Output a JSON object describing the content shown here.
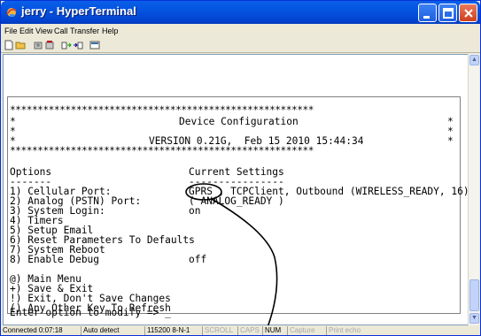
{
  "window": {
    "title": "jerry - HyperTerminal"
  },
  "menu": [
    "File",
    "Edit",
    "View",
    "Call",
    "Transfer",
    "Help"
  ],
  "toolbar": {
    "icons": [
      "new-icon",
      "open-icon",
      "phone-icon",
      "disconnect-icon",
      "send-icon",
      "receive-icon",
      "properties-icon"
    ]
  },
  "terminal": {
    "star_line": "*******************************************************",
    "header_title": "Device Configuration",
    "header_version": "VERSION 0.21G,  Feb 15 2010 15:44:34",
    "col_options": "Options",
    "col_options_rule": "-------",
    "col_settings": "Current Settings",
    "col_settings_rule": "----------------",
    "options": [
      {
        "label": "1) Cellular Port:",
        "value": "GPRS , TCPClient, Outbound (WIRELESS_READY, 16)"
      },
      {
        "label": "2) Analog (PSTN) Port:",
        "value": "( ANALOG_READY )"
      },
      {
        "label": "3) System Login:",
        "value": "on"
      },
      {
        "label": "4) Timers",
        "value": ""
      },
      {
        "label": "5) Setup Email",
        "value": ""
      },
      {
        "label": "6) Reset Parameters To Defaults",
        "value": ""
      },
      {
        "label": "7) System Reboot",
        "value": ""
      },
      {
        "label": "8) Enable Debug",
        "value": "off"
      }
    ],
    "commands": [
      "@) Main Menu",
      "+) Save & Exit",
      "!) Exit, Don't Save Changes",
      "() Any Other Key To Refresh"
    ],
    "prompt": "Enter option to modify => _"
  },
  "status": {
    "connected": "Connected 0:07:18",
    "detect": "Auto detect",
    "port": "115200 8-N-1",
    "scroll": "SCROLL",
    "caps": "CAPS",
    "num": "NUM",
    "capture": "Capture",
    "print": "Print echo"
  }
}
